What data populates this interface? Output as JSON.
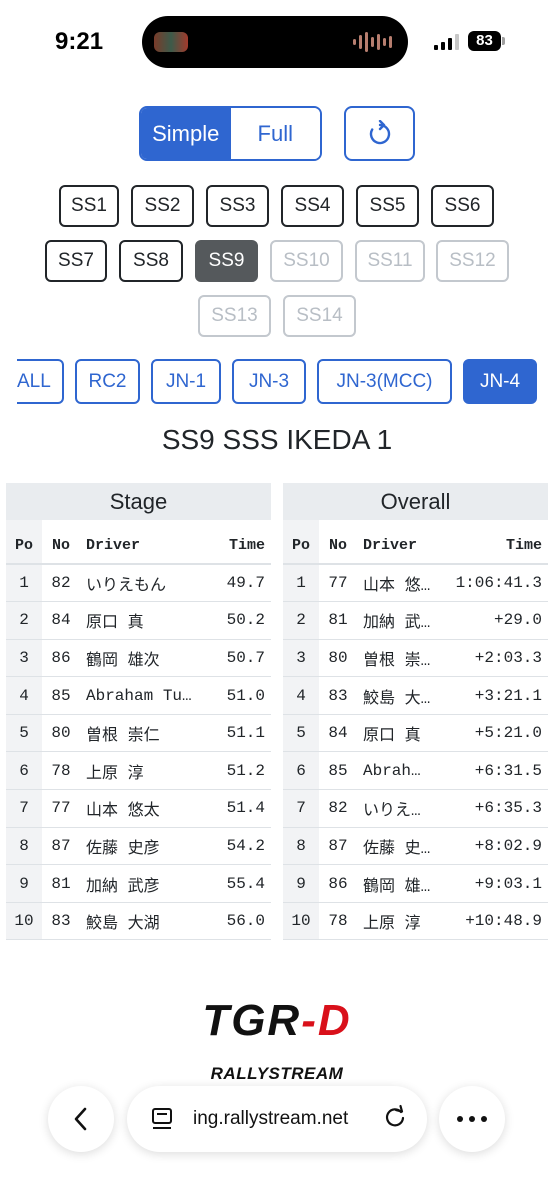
{
  "status_bar": {
    "time": "9:21",
    "battery": "83"
  },
  "controls": {
    "mode_simple": "Simple",
    "mode_full": "Full",
    "active_mode": "Simple",
    "refresh_icon": "refresh-icon"
  },
  "stages": [
    {
      "label": "SS1",
      "state": "normal"
    },
    {
      "label": "SS2",
      "state": "normal"
    },
    {
      "label": "SS3",
      "state": "normal"
    },
    {
      "label": "SS4",
      "state": "normal"
    },
    {
      "label": "SS5",
      "state": "normal"
    },
    {
      "label": "SS6",
      "state": "normal"
    },
    {
      "label": "SS7",
      "state": "normal"
    },
    {
      "label": "SS8",
      "state": "normal"
    },
    {
      "label": "SS9",
      "state": "active"
    },
    {
      "label": "SS10",
      "state": "disabled"
    },
    {
      "label": "SS11",
      "state": "disabled"
    },
    {
      "label": "SS12",
      "state": "disabled"
    },
    {
      "label": "SS13",
      "state": "disabled"
    },
    {
      "label": "SS14",
      "state": "disabled"
    }
  ],
  "classes": [
    {
      "label": "ALL",
      "active": false
    },
    {
      "label": "RC2",
      "active": false
    },
    {
      "label": "JN-1",
      "active": false
    },
    {
      "label": "JN-3",
      "active": false
    },
    {
      "label": "JN-3(MCC)",
      "active": false
    },
    {
      "label": "JN-4",
      "active": true
    }
  ],
  "stage_title": "SS9 SSS IKEDA 1",
  "stage_table": {
    "title": "Stage",
    "headers": {
      "po": "Po",
      "no": "No",
      "driver": "Driver",
      "time": "Time"
    },
    "rows": [
      {
        "po": "1",
        "no": "82",
        "driver": "いりえもん",
        "time": "49.7"
      },
      {
        "po": "2",
        "no": "84",
        "driver": "原口 真",
        "time": "50.2"
      },
      {
        "po": "3",
        "no": "86",
        "driver": "鶴岡 雄次",
        "time": "50.7"
      },
      {
        "po": "4",
        "no": "85",
        "driver": "Abraham Tu…",
        "time": "51.0"
      },
      {
        "po": "5",
        "no": "80",
        "driver": "曽根 崇仁",
        "time": "51.1"
      },
      {
        "po": "6",
        "no": "78",
        "driver": "上原 淳",
        "time": "51.2"
      },
      {
        "po": "7",
        "no": "77",
        "driver": "山本 悠太",
        "time": "51.4"
      },
      {
        "po": "8",
        "no": "87",
        "driver": "佐藤 史彦",
        "time": "54.2"
      },
      {
        "po": "9",
        "no": "81",
        "driver": "加納 武彦",
        "time": "55.4"
      },
      {
        "po": "10",
        "no": "83",
        "driver": "鮫島 大湖",
        "time": "56.0"
      }
    ]
  },
  "overall_table": {
    "title": "Overall",
    "headers": {
      "po": "Po",
      "no": "No",
      "driver": "Driver",
      "time": "Time"
    },
    "rows": [
      {
        "po": "1",
        "no": "77",
        "driver": "山本 悠…",
        "time": "1:06:41.3"
      },
      {
        "po": "2",
        "no": "81",
        "driver": "加納 武…",
        "time": "+29.0"
      },
      {
        "po": "3",
        "no": "80",
        "driver": "曽根 崇…",
        "time": "+2:03.3"
      },
      {
        "po": "4",
        "no": "83",
        "driver": "鮫島 大…",
        "time": "+3:21.1"
      },
      {
        "po": "5",
        "no": "84",
        "driver": "原口 真",
        "time": "+5:21.0"
      },
      {
        "po": "6",
        "no": "85",
        "driver": "Abrah…",
        "time": "+6:31.5"
      },
      {
        "po": "7",
        "no": "82",
        "driver": "いりえ…",
        "time": "+6:35.3"
      },
      {
        "po": "8",
        "no": "87",
        "driver": "佐藤 史…",
        "time": "+8:02.9"
      },
      {
        "po": "9",
        "no": "86",
        "driver": "鶴岡 雄…",
        "time": "+9:03.1"
      },
      {
        "po": "10",
        "no": "78",
        "driver": "上原 淳",
        "time": "+10:48.9"
      }
    ]
  },
  "branding": {
    "logo_left": "TGR",
    "logo_right": "-D",
    "logo_sub": "RALLYSTREAM"
  },
  "browser": {
    "url": "ing.rallystream.net"
  },
  "colors": {
    "primary": "#2f66d0",
    "active_stage": "#55595c",
    "logo_red": "#d9101a"
  }
}
